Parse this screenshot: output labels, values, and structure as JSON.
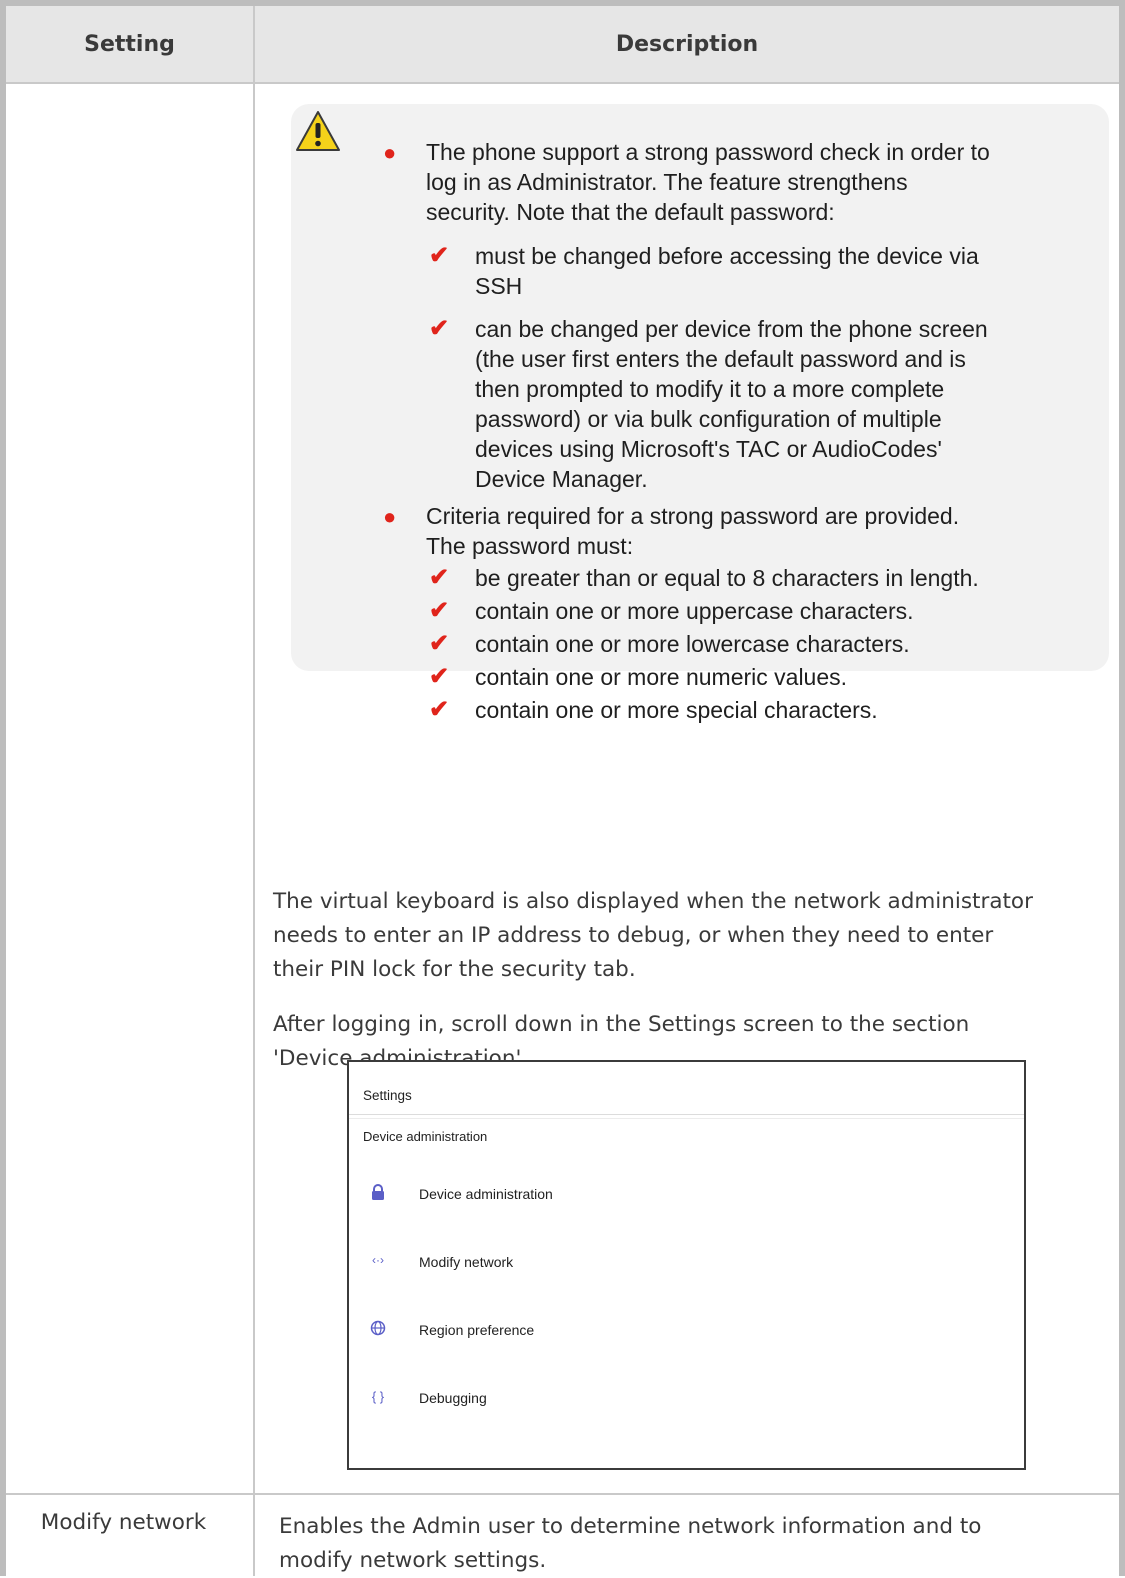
{
  "table": {
    "header_setting": "Setting",
    "header_description": "Description"
  },
  "note": {
    "icon": "warning-icon",
    "bullet1": {
      "lines": [
        "The phone support a strong password check in order to",
        "log in as Administrator. The feature strengthens",
        "security. Note that the default password:"
      ],
      "checks": [
        [
          "must be changed before accessing the device via",
          "SSH"
        ],
        [
          "can be changed per device from the phone screen",
          "(the user first enters the default password and is",
          "then prompted to modify it to a more complete",
          "password) or via bulk configuration of multiple",
          "devices using Microsoft's TAC or AudioCodes'",
          "Device Manager."
        ]
      ]
    },
    "bullet2": {
      "lines": [
        "Criteria required for a strong password are provided.",
        "The password must:"
      ],
      "checks": [
        "be greater than or equal to 8 characters in length.",
        "contain one or more uppercase characters.",
        "contain one or more lowercase characters.",
        "contain one or more numeric values.",
        "contain one or more special characters."
      ]
    }
  },
  "para1": [
    "The virtual keyboard is also displayed when the network administrator",
    "needs to enter an IP address to debug, or when they need to enter",
    "their PIN lock for the security tab."
  ],
  "para2": [
    "After logging in, scroll down in the Settings screen to the section",
    "'Device administration'."
  ],
  "screenshot": {
    "title": "Settings",
    "section": "Device administration",
    "items": [
      {
        "icon": "lock-icon",
        "label": "Device administration"
      },
      {
        "icon": "network-icon",
        "label": "Modify network"
      },
      {
        "icon": "globe-icon",
        "label": "Region preference"
      },
      {
        "icon": "braces-icon",
        "label": "Debugging"
      }
    ]
  },
  "row2": {
    "setting": "Modify network",
    "description": [
      "Enables the Admin user to determine network information and to",
      "modify network settings."
    ]
  },
  "colors": {
    "accent_red": "#e0241b",
    "icon_purple": "#5b5fc7",
    "header_bg": "#e6e6e6"
  }
}
